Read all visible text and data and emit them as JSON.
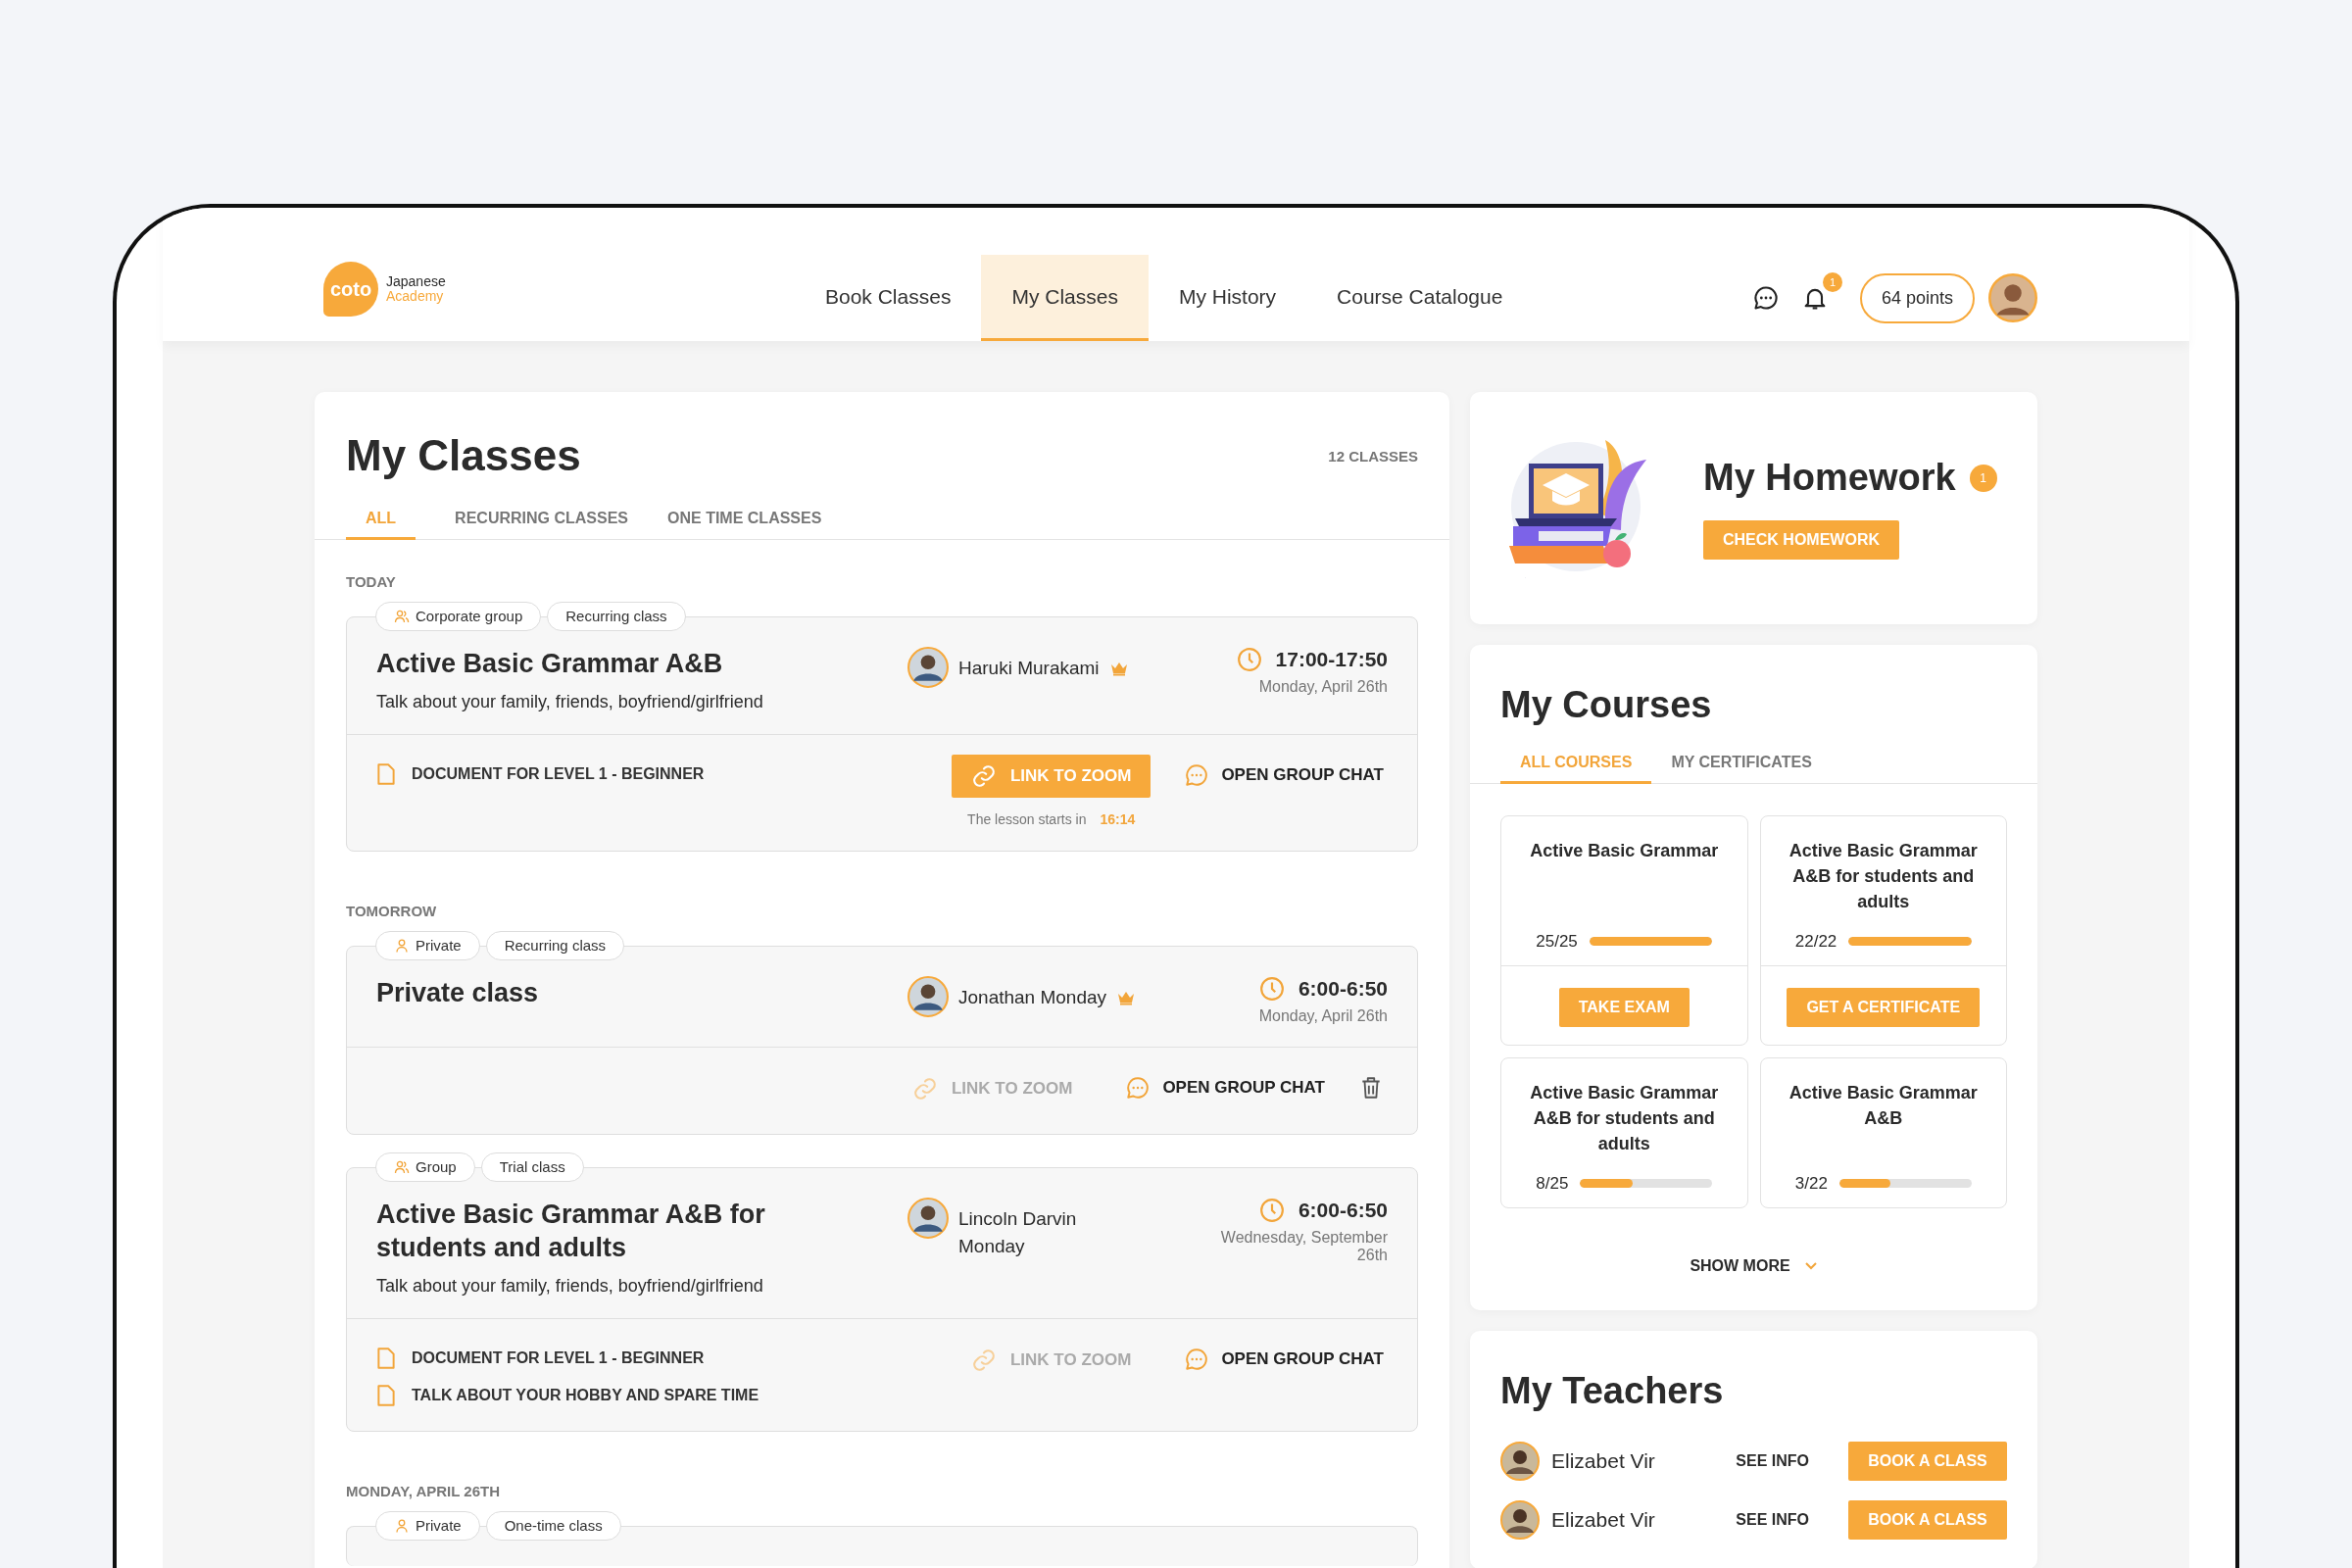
{
  "header": {
    "logo": {
      "mark": "coto",
      "line1": "Japanese",
      "line2": "Academy"
    },
    "nav": [
      {
        "label": "Book Classes",
        "selected": false
      },
      {
        "label": "My Classes",
        "selected": true
      },
      {
        "label": "My History",
        "selected": false
      },
      {
        "label": "Course Catalogue",
        "selected": false
      }
    ],
    "notification_count": "1",
    "points": "64 points"
  },
  "my_classes": {
    "title": "My Classes",
    "count": "12 CLASSES",
    "tabs": [
      {
        "label": "ALL",
        "selected": true
      },
      {
        "label": "RECURRING CLASSES",
        "selected": false
      },
      {
        "label": "ONE TIME CLASSES",
        "selected": false
      }
    ],
    "sections": [
      {
        "heading": "TODAY",
        "classes": [
          {
            "tags": [
              {
                "label": "Corporate group",
                "kind": "group"
              },
              {
                "label": "Recurring class",
                "kind": "plain"
              }
            ],
            "title": "Active Basic Grammar A&B",
            "description": "Talk about your family, friends, boyfriend/girlfriend",
            "teacher": {
              "name": "Haruki Murakami",
              "crown": true
            },
            "time": "17:00-17:50",
            "date": "Monday, April 26th",
            "documents": [
              "DOCUMENT FOR LEVEL 1 - BEGINNER"
            ],
            "zoom": {
              "label": "LINK TO ZOOM",
              "enabled": true
            },
            "countdown": {
              "text": "The lesson starts in",
              "time": "16:14"
            },
            "chat": "OPEN GROUP CHAT",
            "deletable": false
          }
        ]
      },
      {
        "heading": "TOMORROW",
        "classes": [
          {
            "tags": [
              {
                "label": "Private",
                "kind": "person"
              },
              {
                "label": "Recurring class",
                "kind": "plain"
              }
            ],
            "title": "Private class",
            "teacher": {
              "name": "Jonathan Monday",
              "crown": true
            },
            "time": "6:00-6:50",
            "date": "Monday, April 26th",
            "zoom": {
              "label": "LINK TO ZOOM",
              "enabled": false
            },
            "chat": "OPEN GROUP CHAT",
            "deletable": true
          },
          {
            "tags": [
              {
                "label": "Group",
                "kind": "group"
              },
              {
                "label": "Trial class",
                "kind": "plain"
              }
            ],
            "title": "Active Basic Grammar A&B for students and adults",
            "description": "Talk about your family, friends, boyfriend/girlfriend",
            "teacher": {
              "name": "Lincoln Darvin Monday",
              "crown": false
            },
            "time": "6:00-6:50",
            "date": "Wednesday, September 26th",
            "documents": [
              "DOCUMENT FOR LEVEL 1 - BEGINNER",
              "TALK ABOUT YOUR HOBBY AND SPARE TIME"
            ],
            "zoom": {
              "label": "LINK TO ZOOM",
              "enabled": false
            },
            "chat": "OPEN GROUP CHAT",
            "deletable": false
          }
        ]
      },
      {
        "heading": "MONDAY, APRIL 26TH",
        "classes": [
          {
            "tags": [
              {
                "label": "Private",
                "kind": "person"
              },
              {
                "label": "One-time class",
                "kind": "plain"
              }
            ]
          }
        ]
      }
    ]
  },
  "homework": {
    "title": "My Homework",
    "badge": "1",
    "button": "CHECK HOMEWORK"
  },
  "courses": {
    "title": "My Courses",
    "tabs": [
      {
        "label": "ALL COURSES",
        "selected": true
      },
      {
        "label": "MY CERTIFICATES",
        "selected": false
      }
    ],
    "items": [
      {
        "title": "Active Basic Grammar",
        "progress": "25/25",
        "level": 1,
        "button": "TAKE EXAM"
      },
      {
        "title": "Active Basic Grammar A&B for students and adults",
        "progress": "22/22",
        "level": 1,
        "button": "GET A CERTIFICATE"
      },
      {
        "title": "Active Basic Grammar A&B for students and adults",
        "progress": "8/25",
        "level": 0.4
      },
      {
        "title": "Active Basic Grammar A&B",
        "progress": "3/22",
        "level": 0.39
      }
    ],
    "show_more": "SHOW MORE"
  },
  "teachers": {
    "title": "My Teachers",
    "items": [
      {
        "name": "Elizabet Vir",
        "info": "SEE INFO",
        "button": "BOOK A CLASS"
      },
      {
        "name": "Elizabet Vir",
        "info": "SEE INFO",
        "button": "BOOK A CLASS"
      }
    ]
  }
}
